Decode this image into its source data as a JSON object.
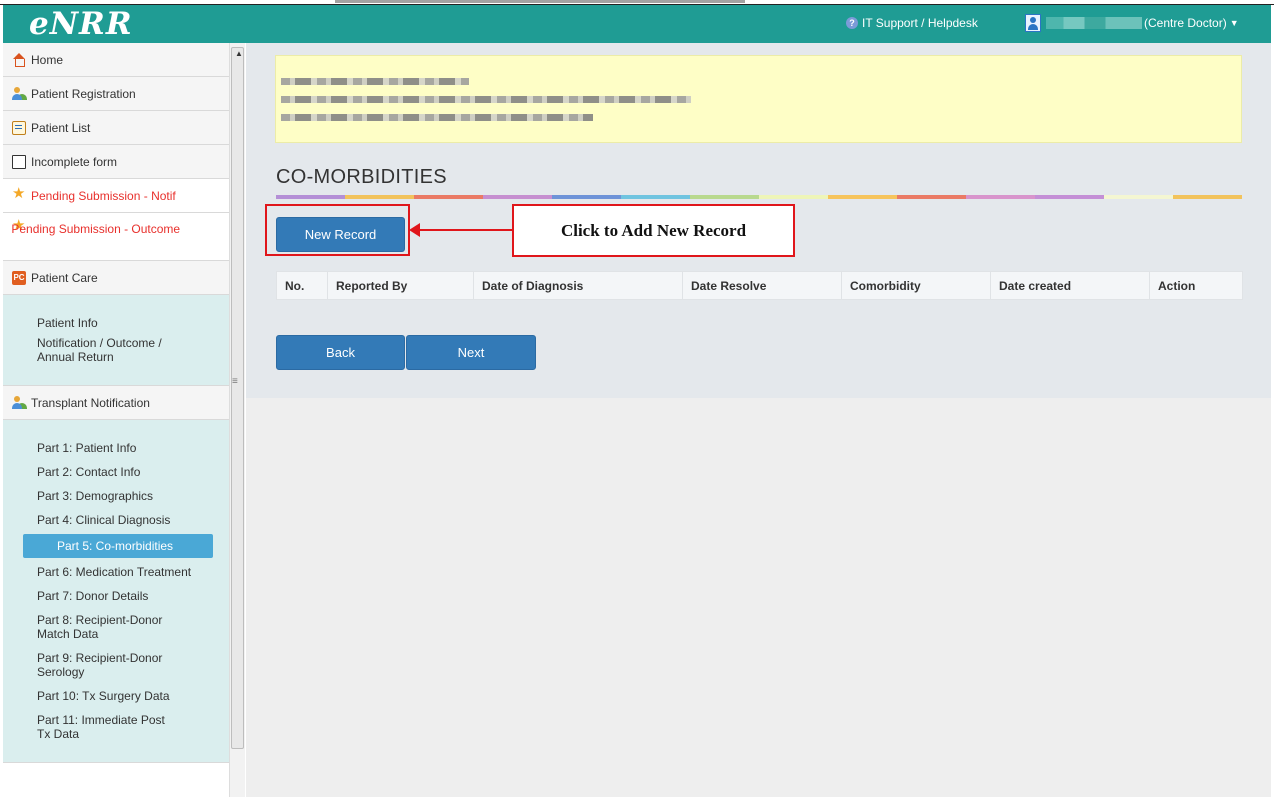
{
  "app": {
    "logo": "eNRR"
  },
  "header": {
    "helpdesk_label": "IT Support / Helpdesk",
    "user_role": "(Centre Doctor)"
  },
  "sidebar": {
    "items": [
      {
        "label": "Home",
        "icon": "home-icon"
      },
      {
        "label": "Patient Registration",
        "icon": "users-icon"
      },
      {
        "label": "Patient List",
        "icon": "list-icon"
      },
      {
        "label": "Incomplete form",
        "icon": "form-icon"
      },
      {
        "label": "Pending Submission - Notif",
        "icon": "star-icon"
      },
      {
        "label": "Pending Submission - Outcome",
        "icon": "star-icon"
      },
      {
        "label": "Patient Care",
        "icon": "pc-icon"
      }
    ],
    "care_sub": [
      "Patient Info",
      "Notification / Outcome / Annual Return"
    ],
    "transplant": {
      "label": "Transplant Notification",
      "icon": "users-icon"
    },
    "parts": [
      "Part 1: Patient Info",
      "Part 2: Contact Info",
      "Part 3: Demographics",
      "Part 4: Clinical Diagnosis",
      "Part 5: Co-morbidities",
      "Part 6: Medication Treatment",
      "Part 7: Donor Details",
      "Part 8: Recipient-Donor Match Data",
      "Part 9: Recipient-Donor Serology",
      "Part 10: Tx Surgery Data",
      "Part 11: Immediate Post Tx Data"
    ],
    "active_part": "Part 5: Co-morbidities"
  },
  "main": {
    "section_title": "CO-MORBIDITIES",
    "new_record_label": "New Record",
    "callout": "Click to Add New Record",
    "table_headers": [
      "No.",
      "Reported By",
      "Date of Diagnosis",
      "Date Resolve",
      "Comorbidity",
      "Date created",
      "Action"
    ],
    "back_label": "Back",
    "next_label": "Next"
  },
  "colors": {
    "header_bg": "#1f9c94",
    "button_bg": "#337ab7",
    "active_item_bg": "#4aa8d6",
    "pending_text": "#e8302c",
    "annotation_red": "#e0161b",
    "info_box_bg": "#fefec6"
  }
}
